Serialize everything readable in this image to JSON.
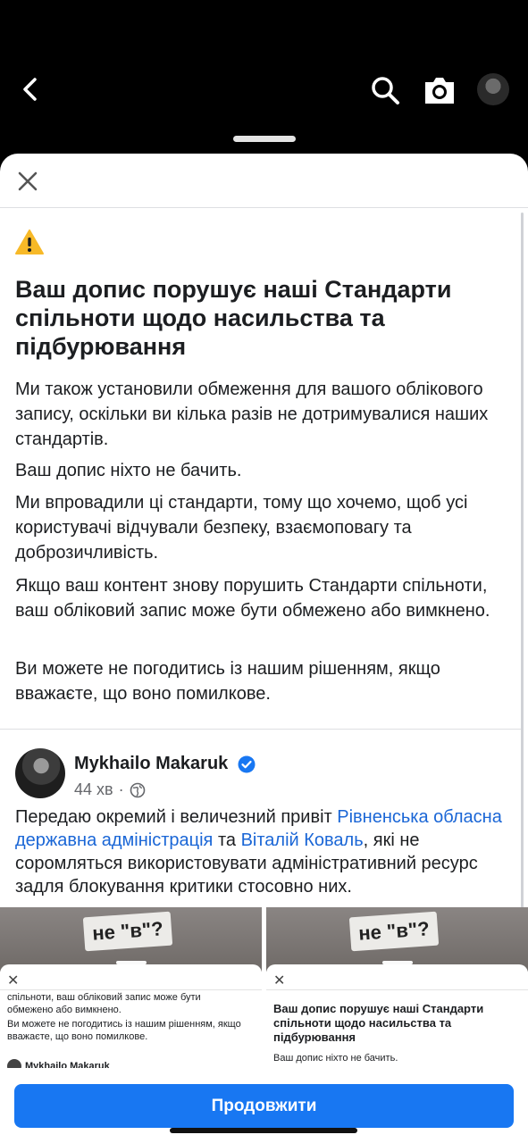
{
  "topbar": {
    "back_icon": "chevron-left-icon",
    "search_icon": "search-icon",
    "camera_icon": "camera-icon"
  },
  "sheet": {
    "close_icon": "close-icon",
    "warning_icon": "warning-icon",
    "title": "Ваш допис порушує наші Стандарти спільноти щодо насильства та підбурювання",
    "paragraphs": [
      "Ми також установили обмеження для вашого облікового запису, оскільки ви кілька разів не дотримувалися наших стандартів.",
      "Ваш допис ніхто не бачить.",
      "Ми впровадили ці стандарти, тому що хочемо, щоб усі користувачі відчували безпеку, взаємоповагу та доброзичливість.",
      "Якщо ваш контент знову порушить Стандарти спільноти, ваш обліковий запис може бути обмежено або вимкнено.",
      "Ви можете не погодитись із нашим рішенням, якщо вважаєте, що воно помилкове."
    ]
  },
  "post": {
    "author": "Mykhailo Makaruk",
    "time": "44 хв",
    "separator": "·",
    "text_1": "Передаю окремий і величезний привіт ",
    "link_1": "Рівненська обласна державна адміністрація",
    "text_2": " та ",
    "link_2": "Віталій Коваль",
    "text_3": ", які не соромляться використовувати адміністративний ресурс задля блокування критики стосовно них.",
    "thumbnails": [
      {
        "sign": "не \"в\"?",
        "lines": [
          "спільноти, ваш обліковий запис може бути обмежено або вимкнено.",
          "Ви можете не погодитись із нашим рішенням, якщо вважаєте, що воно помилкове."
        ],
        "author": "Mykhailo Makaruk"
      },
      {
        "sign": "не \"в\"?",
        "title": "Ваш допис порушує наші Стандарти спільноти щодо насильства та підбурювання",
        "line": "Ваш допис ніхто не бачить."
      }
    ]
  },
  "actions": {
    "continue_label": "Продовжити"
  },
  "colors": {
    "accent": "#1877f2",
    "link": "#1a66d6",
    "warning": "#f7b928"
  }
}
